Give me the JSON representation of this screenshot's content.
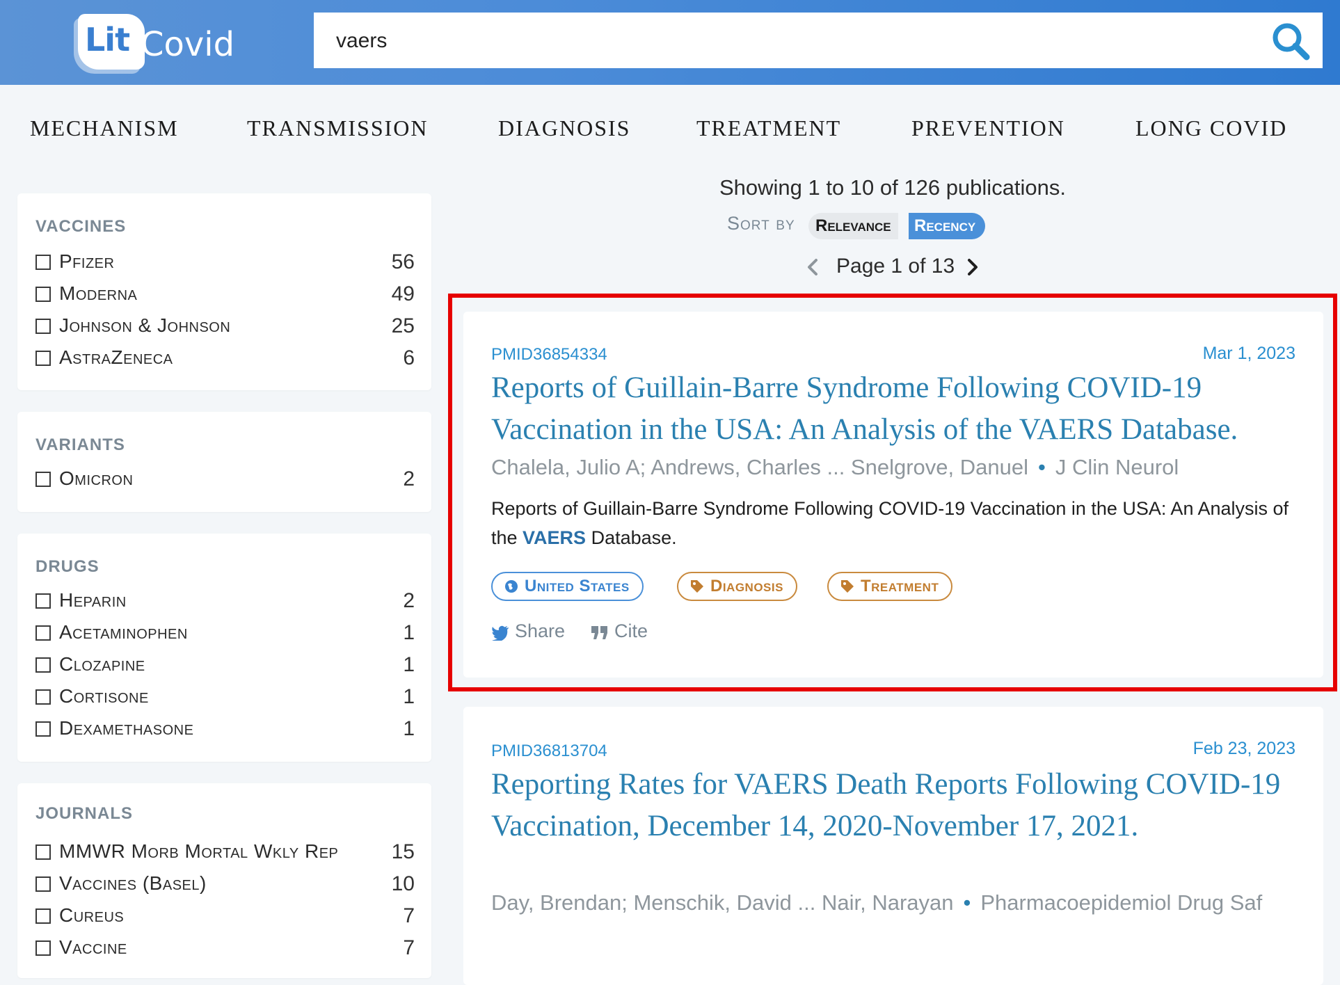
{
  "header": {
    "logo_lit": "Lit",
    "logo_covid": "Covid",
    "search_value": "vaers",
    "search_icon": "search-icon"
  },
  "nav": {
    "items": [
      "MECHANISM",
      "TRANSMISSION",
      "DIAGNOSIS",
      "TREATMENT",
      "PREVENTION",
      "LONG COVID"
    ]
  },
  "filters": [
    {
      "title": "VACCINES",
      "items": [
        {
          "label": "Pfizer",
          "count": "56"
        },
        {
          "label": "Moderna",
          "count": "49"
        },
        {
          "label": "Johnson & Johnson",
          "count": "25"
        },
        {
          "label": "AstraZeneca",
          "count": "6"
        }
      ]
    },
    {
      "title": "VARIANTS",
      "items": [
        {
          "label": "Omicron",
          "count": "2"
        }
      ]
    },
    {
      "title": "DRUGS",
      "items": [
        {
          "label": "Heparin",
          "count": "2"
        },
        {
          "label": "Acetaminophen",
          "count": "1"
        },
        {
          "label": "Clozapine",
          "count": "1"
        },
        {
          "label": "Cortisone",
          "count": "1"
        },
        {
          "label": "Dexamethasone",
          "count": "1"
        }
      ]
    },
    {
      "title": "JOURNALS",
      "items": [
        {
          "label": "MMWR Morb Mortal Wkly Rep",
          "count": "15"
        },
        {
          "label": "Vaccines (Basel)",
          "count": "10"
        },
        {
          "label": "Cureus",
          "count": "7"
        },
        {
          "label": "Vaccine",
          "count": "7"
        }
      ]
    }
  ],
  "results_header": {
    "count_text": "Showing 1 to 10 of 126 publications.",
    "sort_label": "Sort by",
    "sort_relevance": "Relevance",
    "sort_recency": "Recency",
    "page_label": "Page 1 of 13"
  },
  "results": [
    {
      "pmid": "PMID36854334",
      "date": "Mar 1, 2023",
      "title": "Reports of Guillain-Barre Syndrome Following COVID-19 Vaccination in the USA: An Analysis of the VAERS Database.",
      "authors": "Chalela, Julio A; Andrews, Charles ... Snelgrove, Danuel",
      "journal": "J Clin Neurol",
      "snippet_before": "Reports of Guillain-Barre Syndrome Following COVID-19 Vaccination in the USA: An Analysis of the ",
      "snippet_highlight": "VAERS",
      "snippet_after": " Database.",
      "tags": {
        "country": "United States",
        "topic1": "Diagnosis",
        "topic2": "Treatment"
      },
      "share": "Share",
      "cite": "Cite"
    },
    {
      "pmid": "PMID36813704",
      "date": "Feb 23, 2023",
      "title": "Reporting Rates for VAERS Death Reports Following COVID-19 Vaccination, December 14, 2020-November 17, 2021.",
      "authors": "Day, Brendan; Menschik, David ... Nair, Narayan",
      "journal": "Pharmacoepidemiol Drug Saf"
    }
  ],
  "colors": {
    "header_blue": "#4c8cd8",
    "link_blue": "#2a80b0",
    "highlight_red": "#e60000",
    "topic_tag": "#c27d2f"
  }
}
